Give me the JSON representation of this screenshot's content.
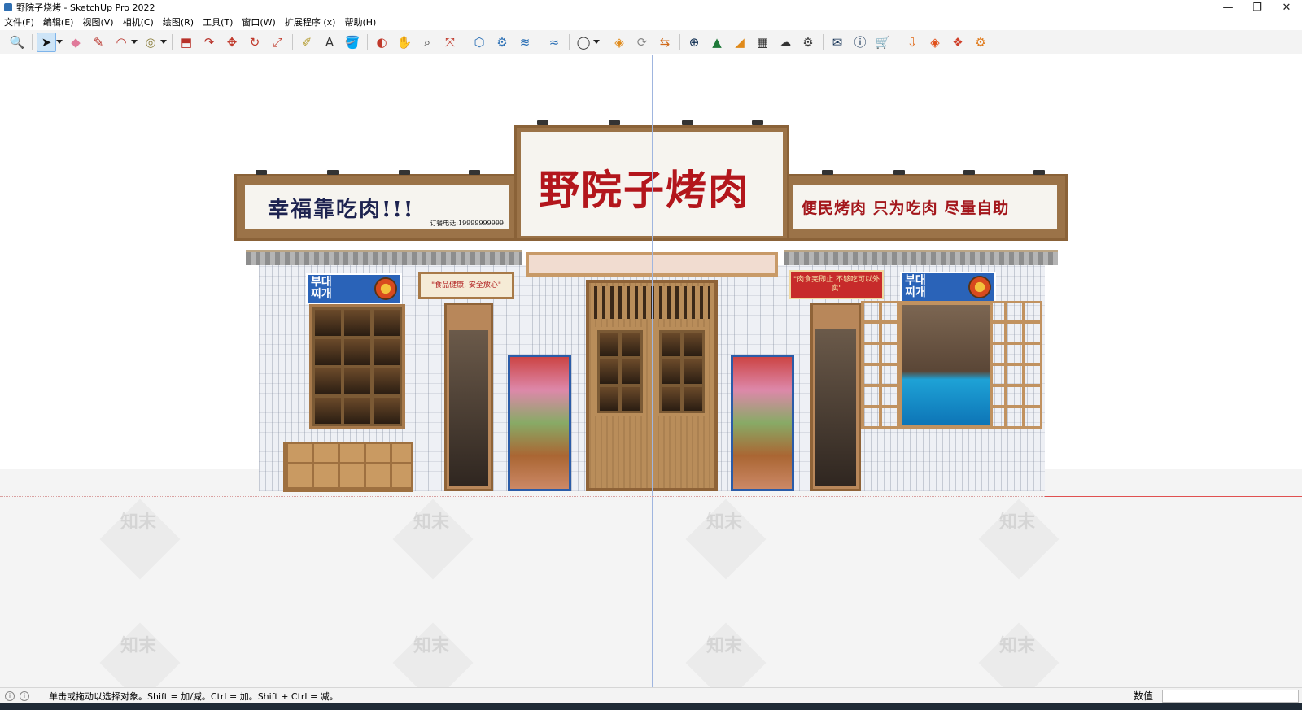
{
  "window": {
    "title": "野院子烧烤 - SketchUp Pro 2022",
    "minimize_glyph": "—",
    "maximize_glyph": "❐",
    "close_glyph": "✕"
  },
  "menu": [
    "文件(F)",
    "编辑(E)",
    "视图(V)",
    "相机(C)",
    "绘图(R)",
    "工具(T)",
    "窗口(W)",
    "扩展程序 (x)",
    "帮助(H)"
  ],
  "toolbar": {
    "buttons": [
      {
        "name": "zoom-icon",
        "glyph": "🔍",
        "color": "#333333"
      },
      {
        "name": "select-icon",
        "glyph": "➤",
        "color": "#111111",
        "selected": true
      },
      {
        "name": "eraser-icon",
        "glyph": "◆",
        "color": "#e07a9a"
      },
      {
        "name": "pencil-icon",
        "glyph": "✎",
        "color": "#b8322a"
      },
      {
        "name": "arc-icon",
        "glyph": "◠",
        "color": "#b8322a"
      },
      {
        "name": "shape-icon",
        "glyph": "◎",
        "color": "#8a7d3a"
      },
      {
        "name": "push-pull-icon",
        "glyph": "⬒",
        "color": "#b8322a"
      },
      {
        "name": "follow-me-icon",
        "glyph": "↷",
        "color": "#b8322a"
      },
      {
        "name": "move-icon",
        "glyph": "✥",
        "color": "#c0392b"
      },
      {
        "name": "rotate-icon",
        "glyph": "↻",
        "color": "#c0392b"
      },
      {
        "name": "scale-icon",
        "glyph": "⤢",
        "color": "#c0392b"
      },
      {
        "name": "tape-measure-icon",
        "glyph": "✐",
        "color": "#b39a2a"
      },
      {
        "name": "text-icon",
        "glyph": "A",
        "color": "#333333"
      },
      {
        "name": "paint-bucket-icon",
        "glyph": "🪣",
        "color": "#c7a21a"
      },
      {
        "name": "orbit-icon",
        "glyph": "◐",
        "color": "#c0392b"
      },
      {
        "name": "pan-icon",
        "glyph": "✋",
        "color": "#d5a21a"
      },
      {
        "name": "zoom-tool-icon",
        "glyph": "⌕",
        "color": "#333333"
      },
      {
        "name": "zoom-extents-icon",
        "glyph": "⤧",
        "color": "#c0392b"
      },
      {
        "name": "warehouse-icon",
        "glyph": "⬡",
        "color": "#2a6fb5"
      },
      {
        "name": "extension-warehouse-icon",
        "glyph": "⚙",
        "color": "#2a6fb5"
      },
      {
        "name": "layout-icon",
        "glyph": "≋",
        "color": "#2a6fb5"
      },
      {
        "name": "sandbox-icon",
        "glyph": "≈",
        "color": "#2a6fb5"
      },
      {
        "name": "user-account-icon",
        "glyph": "◯",
        "color": "#333333"
      },
      {
        "name": "plugin-1-icon",
        "glyph": "◈",
        "color": "#e08a1a"
      },
      {
        "name": "refresh-icon",
        "glyph": "⟳",
        "color": "#888888"
      },
      {
        "name": "swap-icon",
        "glyph": "⇆",
        "color": "#d06a1a"
      },
      {
        "name": "add-icon",
        "glyph": "⊕",
        "color": "#0b2a4f"
      },
      {
        "name": "tree-icon",
        "glyph": "▲",
        "color": "#1f7a3a"
      },
      {
        "name": "stairs-icon",
        "glyph": "◢",
        "color": "#e08a1a"
      },
      {
        "name": "checker-icon",
        "glyph": "▦",
        "color": "#222222"
      },
      {
        "name": "cloud-upload-icon",
        "glyph": "☁",
        "color": "#333333"
      },
      {
        "name": "gears-icon",
        "glyph": "⚙",
        "color": "#333333"
      },
      {
        "name": "mail-icon",
        "glyph": "✉",
        "color": "#0b2a4f"
      },
      {
        "name": "info-icon",
        "glyph": "ⓘ",
        "color": "#0b2a4f"
      },
      {
        "name": "cart-icon",
        "glyph": "🛒",
        "color": "#0b2a4f"
      },
      {
        "name": "download-icon",
        "glyph": "⇩",
        "color": "#e06a1a"
      },
      {
        "name": "stack-icon",
        "glyph": "◈",
        "color": "#e0501a"
      },
      {
        "name": "cube-icon",
        "glyph": "❖",
        "color": "#d0402a"
      },
      {
        "name": "gear-orange-icon",
        "glyph": "⚙",
        "color": "#e07a1a"
      }
    ]
  },
  "scene": {
    "main_sign": "野院子烤肉",
    "left_sign": "幸福靠吃肉!!!",
    "left_sign_phone": "订餐电话:19999999999",
    "right_sign": "便民烤肉 只为吃肉 尽量自助",
    "korean_badge_1": "부대\n찌개",
    "korean_badge_2": "부대\n찌개",
    "left_small_sign": "\"食品健康, 安全放心\"",
    "right_small_sign": "\"肉食完即止 不够吃可以外卖\"",
    "watermark_text": "知末"
  },
  "statusbar": {
    "message": "单击或拖动以选择对象。Shift = 加/减。Ctrl = 加。Shift + Ctrl = 减。",
    "value_label": "数值",
    "value": ""
  }
}
